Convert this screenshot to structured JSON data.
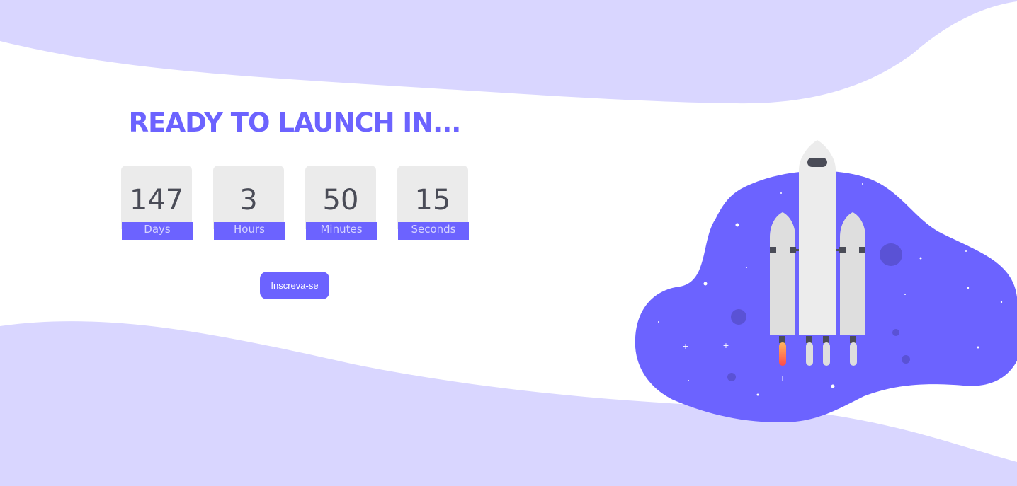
{
  "theme": {
    "accent": "#6c63ff",
    "wave": "#d9d6ff",
    "box": "#ebebeb",
    "digit": "#4a4c57"
  },
  "header": {
    "title": "READY TO LAUNCH IN..."
  },
  "countdown": {
    "units": [
      {
        "value": "147",
        "label": "Days"
      },
      {
        "value": "3",
        "label": "Hours"
      },
      {
        "value": "50",
        "label": "Minutes"
      },
      {
        "value": "15",
        "label": "Seconds"
      }
    ]
  },
  "cta": {
    "label": "Inscreva-se"
  },
  "illustration": {
    "icon": "rocket-launch-illustration"
  }
}
